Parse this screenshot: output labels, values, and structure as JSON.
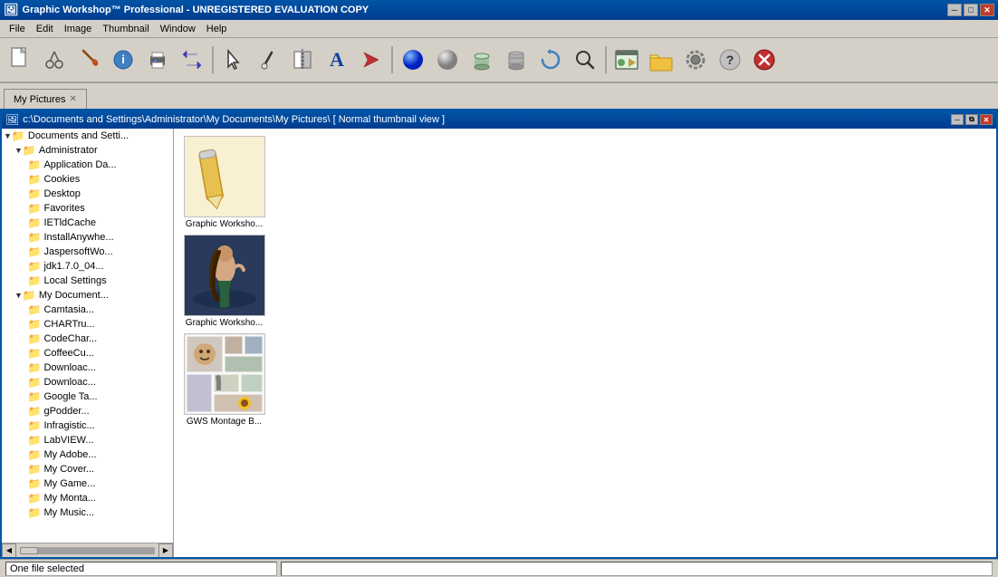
{
  "app": {
    "title": "Graphic Workshop™ Professional - UNREGISTERED EVALUATION COPY",
    "icon": "🖼️"
  },
  "title_controls": {
    "minimize": "─",
    "maximize": "□",
    "close": "✕"
  },
  "menu": {
    "items": [
      "File",
      "Edit",
      "Image",
      "Thumbnail",
      "Window",
      "Help"
    ]
  },
  "toolbar": {
    "buttons": [
      {
        "name": "new",
        "icon": "📄"
      },
      {
        "name": "cut",
        "icon": "✂"
      },
      {
        "name": "paint",
        "icon": "🖌"
      },
      {
        "name": "info",
        "icon": "ℹ"
      },
      {
        "name": "print",
        "icon": "🖨"
      },
      {
        "name": "convert",
        "icon": "↩"
      },
      {
        "name": "pointer",
        "icon": "👆"
      },
      {
        "name": "eyedropper",
        "icon": "💉"
      },
      {
        "name": "flip",
        "icon": "◫"
      },
      {
        "name": "text",
        "icon": "A"
      },
      {
        "name": "effects",
        "icon": "◁"
      },
      {
        "name": "blue-ball",
        "icon": "🔵"
      },
      {
        "name": "grey-ball",
        "icon": "⚪"
      },
      {
        "name": "cylinder",
        "icon": "⬭"
      },
      {
        "name": "barrel",
        "icon": "🗑"
      },
      {
        "name": "rotate",
        "icon": "🔄"
      },
      {
        "name": "search",
        "icon": "🔍"
      },
      {
        "name": "preview",
        "icon": "🖼"
      },
      {
        "name": "folder",
        "icon": "📁"
      },
      {
        "name": "settings",
        "icon": "⚙"
      },
      {
        "name": "help",
        "icon": "❓"
      },
      {
        "name": "close-red",
        "icon": "🔴"
      }
    ]
  },
  "tab": {
    "label": "My Pictures",
    "close": "✕"
  },
  "inner_window": {
    "title": "c:\\Documents and Settings\\Administrator\\My Documents\\My Pictures\\ [ Normal thumbnail view ]",
    "controls": {
      "minimize": "─",
      "maximize": "⧉",
      "close": "✕"
    }
  },
  "tree": {
    "items": [
      {
        "id": "docs-settings",
        "label": "Documents and Setti...",
        "level": 0,
        "expand": "▼",
        "folder": "📁"
      },
      {
        "id": "administrator",
        "label": "Administrator",
        "level": 1,
        "expand": "▼",
        "folder": "📁"
      },
      {
        "id": "appdata",
        "label": "Application Da...",
        "level": 2,
        "expand": "",
        "folder": "📁",
        "selected": false
      },
      {
        "id": "cookies",
        "label": "Cookies",
        "level": 2,
        "expand": "",
        "folder": "📁"
      },
      {
        "id": "desktop",
        "label": "Desktop",
        "level": 2,
        "expand": "",
        "folder": "📁"
      },
      {
        "id": "favorites",
        "label": "Favorites",
        "level": 2,
        "expand": "",
        "folder": "📁"
      },
      {
        "id": "ietchcache",
        "label": "IETldCache",
        "level": 2,
        "expand": "",
        "folder": "📁"
      },
      {
        "id": "installany",
        "label": "InstallAnywhe...",
        "level": 2,
        "expand": "",
        "folder": "📁"
      },
      {
        "id": "jaspersoft",
        "label": "JaspersoftWo...",
        "level": 2,
        "expand": "",
        "folder": "📁"
      },
      {
        "id": "jdk",
        "label": "jdk1.7.0_04...",
        "level": 2,
        "expand": "",
        "folder": "📁"
      },
      {
        "id": "localsettings",
        "label": "Local Settings",
        "level": 2,
        "expand": "",
        "folder": "📁"
      },
      {
        "id": "mydocuments",
        "label": "My Document...",
        "level": 1,
        "expand": "▼",
        "folder": "📁"
      },
      {
        "id": "camtasia",
        "label": "Camtasia...",
        "level": 2,
        "expand": "",
        "folder": "📁"
      },
      {
        "id": "charttru",
        "label": "CHARTru...",
        "level": 2,
        "expand": "",
        "folder": "📁"
      },
      {
        "id": "codechar",
        "label": "CodeChar...",
        "level": 2,
        "expand": "",
        "folder": "📁"
      },
      {
        "id": "coffeecu",
        "label": "CoffeeCu...",
        "level": 2,
        "expand": "",
        "folder": "📁"
      },
      {
        "id": "download1",
        "label": "Downloac...",
        "level": 2,
        "expand": "",
        "folder": "📁"
      },
      {
        "id": "download2",
        "label": "Downloac...",
        "level": 2,
        "expand": "",
        "folder": "📁"
      },
      {
        "id": "googletk",
        "label": "Google Ta...",
        "level": 2,
        "expand": "",
        "folder": "📁"
      },
      {
        "id": "gpodder",
        "label": "gPodder...",
        "level": 2,
        "expand": "",
        "folder": "📁"
      },
      {
        "id": "infragistic",
        "label": "Infragistic...",
        "level": 2,
        "expand": "",
        "folder": "📁"
      },
      {
        "id": "labview",
        "label": "LabVIEW...",
        "level": 2,
        "expand": "",
        "folder": "📁"
      },
      {
        "id": "myadobe",
        "label": "My Adobe...",
        "level": 2,
        "expand": "",
        "folder": "📁"
      },
      {
        "id": "mycover",
        "label": "My Cover...",
        "level": 2,
        "expand": "",
        "folder": "📁"
      },
      {
        "id": "mygames",
        "label": "My Game...",
        "level": 2,
        "expand": "",
        "folder": "📁"
      },
      {
        "id": "mymontage",
        "label": "My Monta...",
        "level": 2,
        "expand": "",
        "folder": "📁"
      },
      {
        "id": "mymusic",
        "label": "My Music...",
        "level": 2,
        "expand": "",
        "folder": "📁"
      }
    ]
  },
  "thumbnails": [
    {
      "id": "thumb1",
      "label": "Graphic Worksho...",
      "type": "logo"
    },
    {
      "id": "thumb2",
      "label": "Graphic Worksho...",
      "type": "painting"
    },
    {
      "id": "thumb3",
      "label": "GWS Montage B...",
      "type": "montage"
    }
  ],
  "status": {
    "text": "One file selected",
    "right": ""
  }
}
